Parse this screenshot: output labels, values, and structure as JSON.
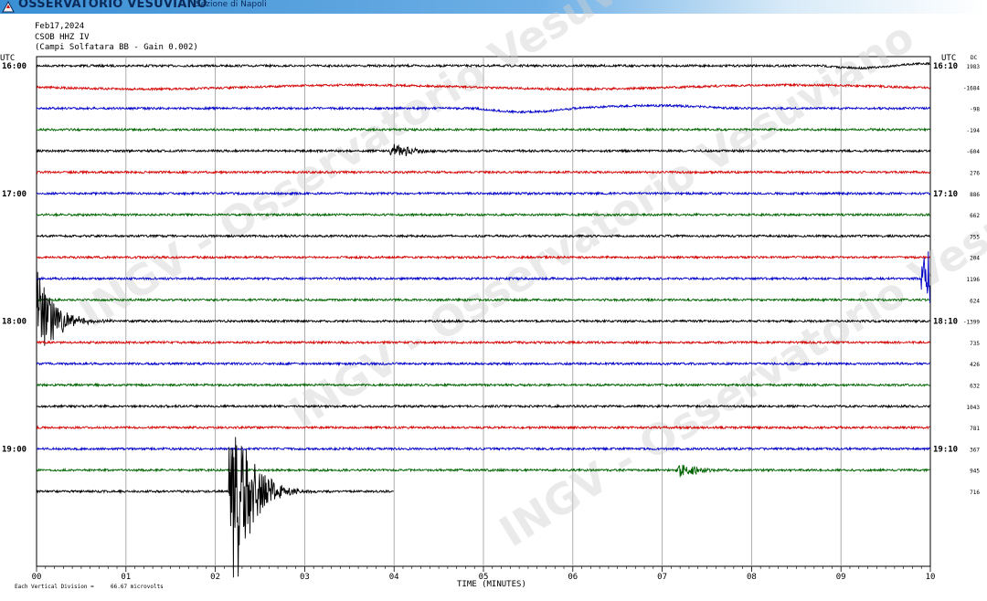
{
  "header": {
    "org": "OSSERVATORIO VESUVIANO",
    "section": "Sezione di Napoli",
    "date": "Feb17,2024",
    "station": "CSOB HHZ IV",
    "location": "(Campi Solfatara BB - Gain 0.002)"
  },
  "labels": {
    "utc_left": "UTC",
    "utc_right": "UTC",
    "dc": "DC",
    "footnote": "Each Vertical Division =",
    "footnote_value": "66.67 microvolts",
    "watermark": "INGV - Osservatorio Vesuviano"
  },
  "chart_data": {
    "type": "line",
    "title": "Feb17,2024",
    "xlabel": "TIME (MINUTES)",
    "ylabel": "",
    "x_ticks": [
      "00",
      "01",
      "02",
      "03",
      "04",
      "05",
      "06",
      "07",
      "08",
      "09",
      "10"
    ],
    "xlim": [
      0,
      10
    ],
    "grid": true,
    "left_time_labels": [
      "16:00",
      "17:00",
      "18:00",
      "19:00"
    ],
    "right_time_labels": [
      "16:10",
      "17:10",
      "18:10",
      "19:10"
    ],
    "dc_offsets": [
      "1983",
      "-1684",
      "-98",
      "-194",
      "-604",
      "276",
      "886",
      "662",
      "755",
      "204",
      "1196",
      "624",
      "-1399",
      "735",
      "426",
      "632",
      "1043",
      "781",
      "367",
      "945",
      "716"
    ],
    "trace_colors": [
      "#000000",
      "#d40000",
      "#0000c8",
      "#006400"
    ],
    "events": [
      {
        "trace": 4,
        "minute": 4.0,
        "amplitude": "small"
      },
      {
        "trace": 10,
        "minute": 9.95,
        "amplitude": "large"
      },
      {
        "trace": 12,
        "minute": 0.0,
        "amplitude": "large"
      },
      {
        "trace": 19,
        "minute": 7.2,
        "amplitude": "small"
      },
      {
        "trace": 20,
        "minute": 2.2,
        "amplitude": "very large"
      }
    ],
    "last_trace_end_minute": 4.0
  }
}
